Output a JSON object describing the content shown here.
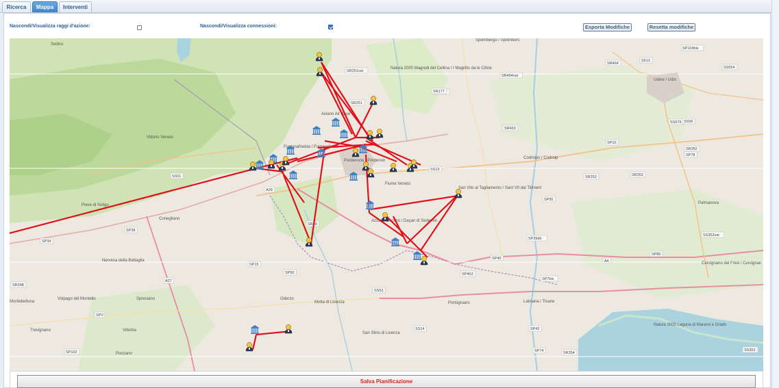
{
  "tabs": [
    {
      "label": "Ricerca",
      "active": false
    },
    {
      "label": "Mappa",
      "active": true
    },
    {
      "label": "Interventi",
      "active": false
    }
  ],
  "options": {
    "raggi_label": "Nascondi/Visualizza raggi d'azione:",
    "raggi_checked": false,
    "connessioni_label": "Nascondi/Visualizza connessioni:",
    "connessioni_checked": true
  },
  "buttons": {
    "export": "Esporta Modifiche",
    "reset": "Resetta modifiche",
    "save": "Salva Pianificazione"
  },
  "map": {
    "places": [
      "Sedico",
      "Spilimbergo / Spilimberc",
      "Udine / Udin",
      "Vittorio Veneto",
      "Pordenone / Pordenon",
      "Fiume Veneto",
      "Codroipo / Codroip",
      "Pieve di Soligo",
      "Conegliano",
      "San Vito al Tagliamento / Sant Vît dal Tiliment",
      "Azzano Decimo / Daçan di Sedenon",
      "Palmanova",
      "Nervesa della Battaglia",
      "Oderzo",
      "Motta di Livenza",
      "Portogruaro",
      "Latisana / Tisane",
      "Cervignano del Friuli / Cervignan",
      "Montebelluna",
      "Volpago del Montello",
      "Spresiano",
      "Villorba",
      "Trevignano",
      "Ponzano",
      "San Stino di Livenza",
      "Aviano Air Base",
      "Natura 2000 Magredi del Cellina / I Magrêts da le Cilìne",
      "Natura 2000 Laguna di Marano e Grado",
      "Fontanafredda / Fontanefrede"
    ],
    "roads": [
      "SR251var",
      "SR251",
      "SR177",
      "SR464",
      "SR464var",
      "SS13",
      "S513",
      "SP10",
      "SR463",
      "SS676",
      "SS56",
      "SR352",
      "SP78",
      "SR353",
      "SR252",
      "SP95",
      "SS51",
      "SP38",
      "SP34",
      "SR348",
      "SR59",
      "SP39dir",
      "SS352var",
      "SP80",
      "A28",
      "A4",
      "SP40",
      "SP463",
      "SP7bis",
      "SS14",
      "SP42",
      "SP74",
      "SR354",
      "SS352",
      "SP15",
      "SP50",
      "SS53",
      "A27",
      "SPV",
      "SP102",
      "SS554",
      "SP104bis",
      "SR177"
    ]
  }
}
